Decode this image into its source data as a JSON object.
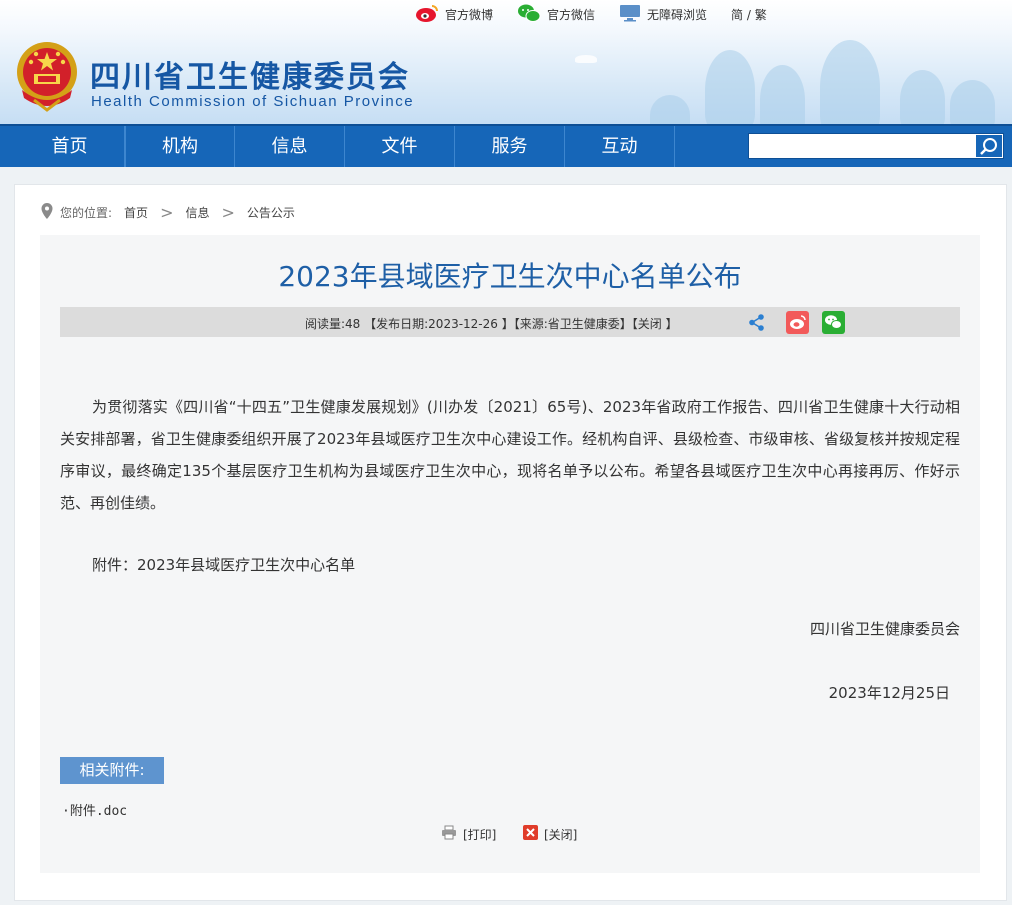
{
  "header": {
    "top_links": [
      {
        "label": "官方微博",
        "icon": "weibo-icon"
      },
      {
        "label": "官方微信",
        "icon": "wechat-icon"
      },
      {
        "label": "无障碍浏览",
        "icon": "monitor-icon"
      },
      {
        "label": "简 / 繁",
        "icon": ""
      }
    ],
    "title_cn": "四川省卫生健康委员会",
    "title_en": "Health Commission of Sichuan Province"
  },
  "nav": {
    "items": [
      "首页",
      "机构",
      "信息",
      "文件",
      "服务",
      "互动"
    ],
    "search_placeholder": ""
  },
  "breadcrumb": {
    "prefix": "您的位置:",
    "items": [
      "首页",
      "信息",
      "公告公示"
    ]
  },
  "article": {
    "title": "2023年县域医疗卫生次中心名单公布",
    "meta": "阅读量:48 【发布日期:2023-12-26 】【来源:省卫生健康委】【关闭 】",
    "paragraph": "为贯彻落实《四川省“十四五”卫生健康发展规划》(川办发〔2021〕65号)、2023年省政府工作报告、四川省卫生健康十大行动相关安排部署，省卫生健康委组织开展了2023年县域医疗卫生次中心建设工作。经机构自评、县级检查、市级审核、省级复核并按规定程序审议，最终确定135个基层医疗卫生机构为县域医疗卫生次中心，现将名单予以公布。希望各县域医疗卫生次中心再接再厉、作好示范、再创佳绩。",
    "attachment_line": "附件：2023年县域医疗卫生次中心名单",
    "signature": "四川省卫生健康委员会",
    "date": "2023年12月25日"
  },
  "attachments": {
    "header": "相关附件:",
    "files": [
      "·附件.doc"
    ]
  },
  "actions": {
    "print": "[打印]",
    "close": "[关闭]"
  },
  "colors": {
    "brand_blue": "#1666b8",
    "title_blue": "#1e5fa6",
    "attachment_header": "#5e94cf"
  }
}
